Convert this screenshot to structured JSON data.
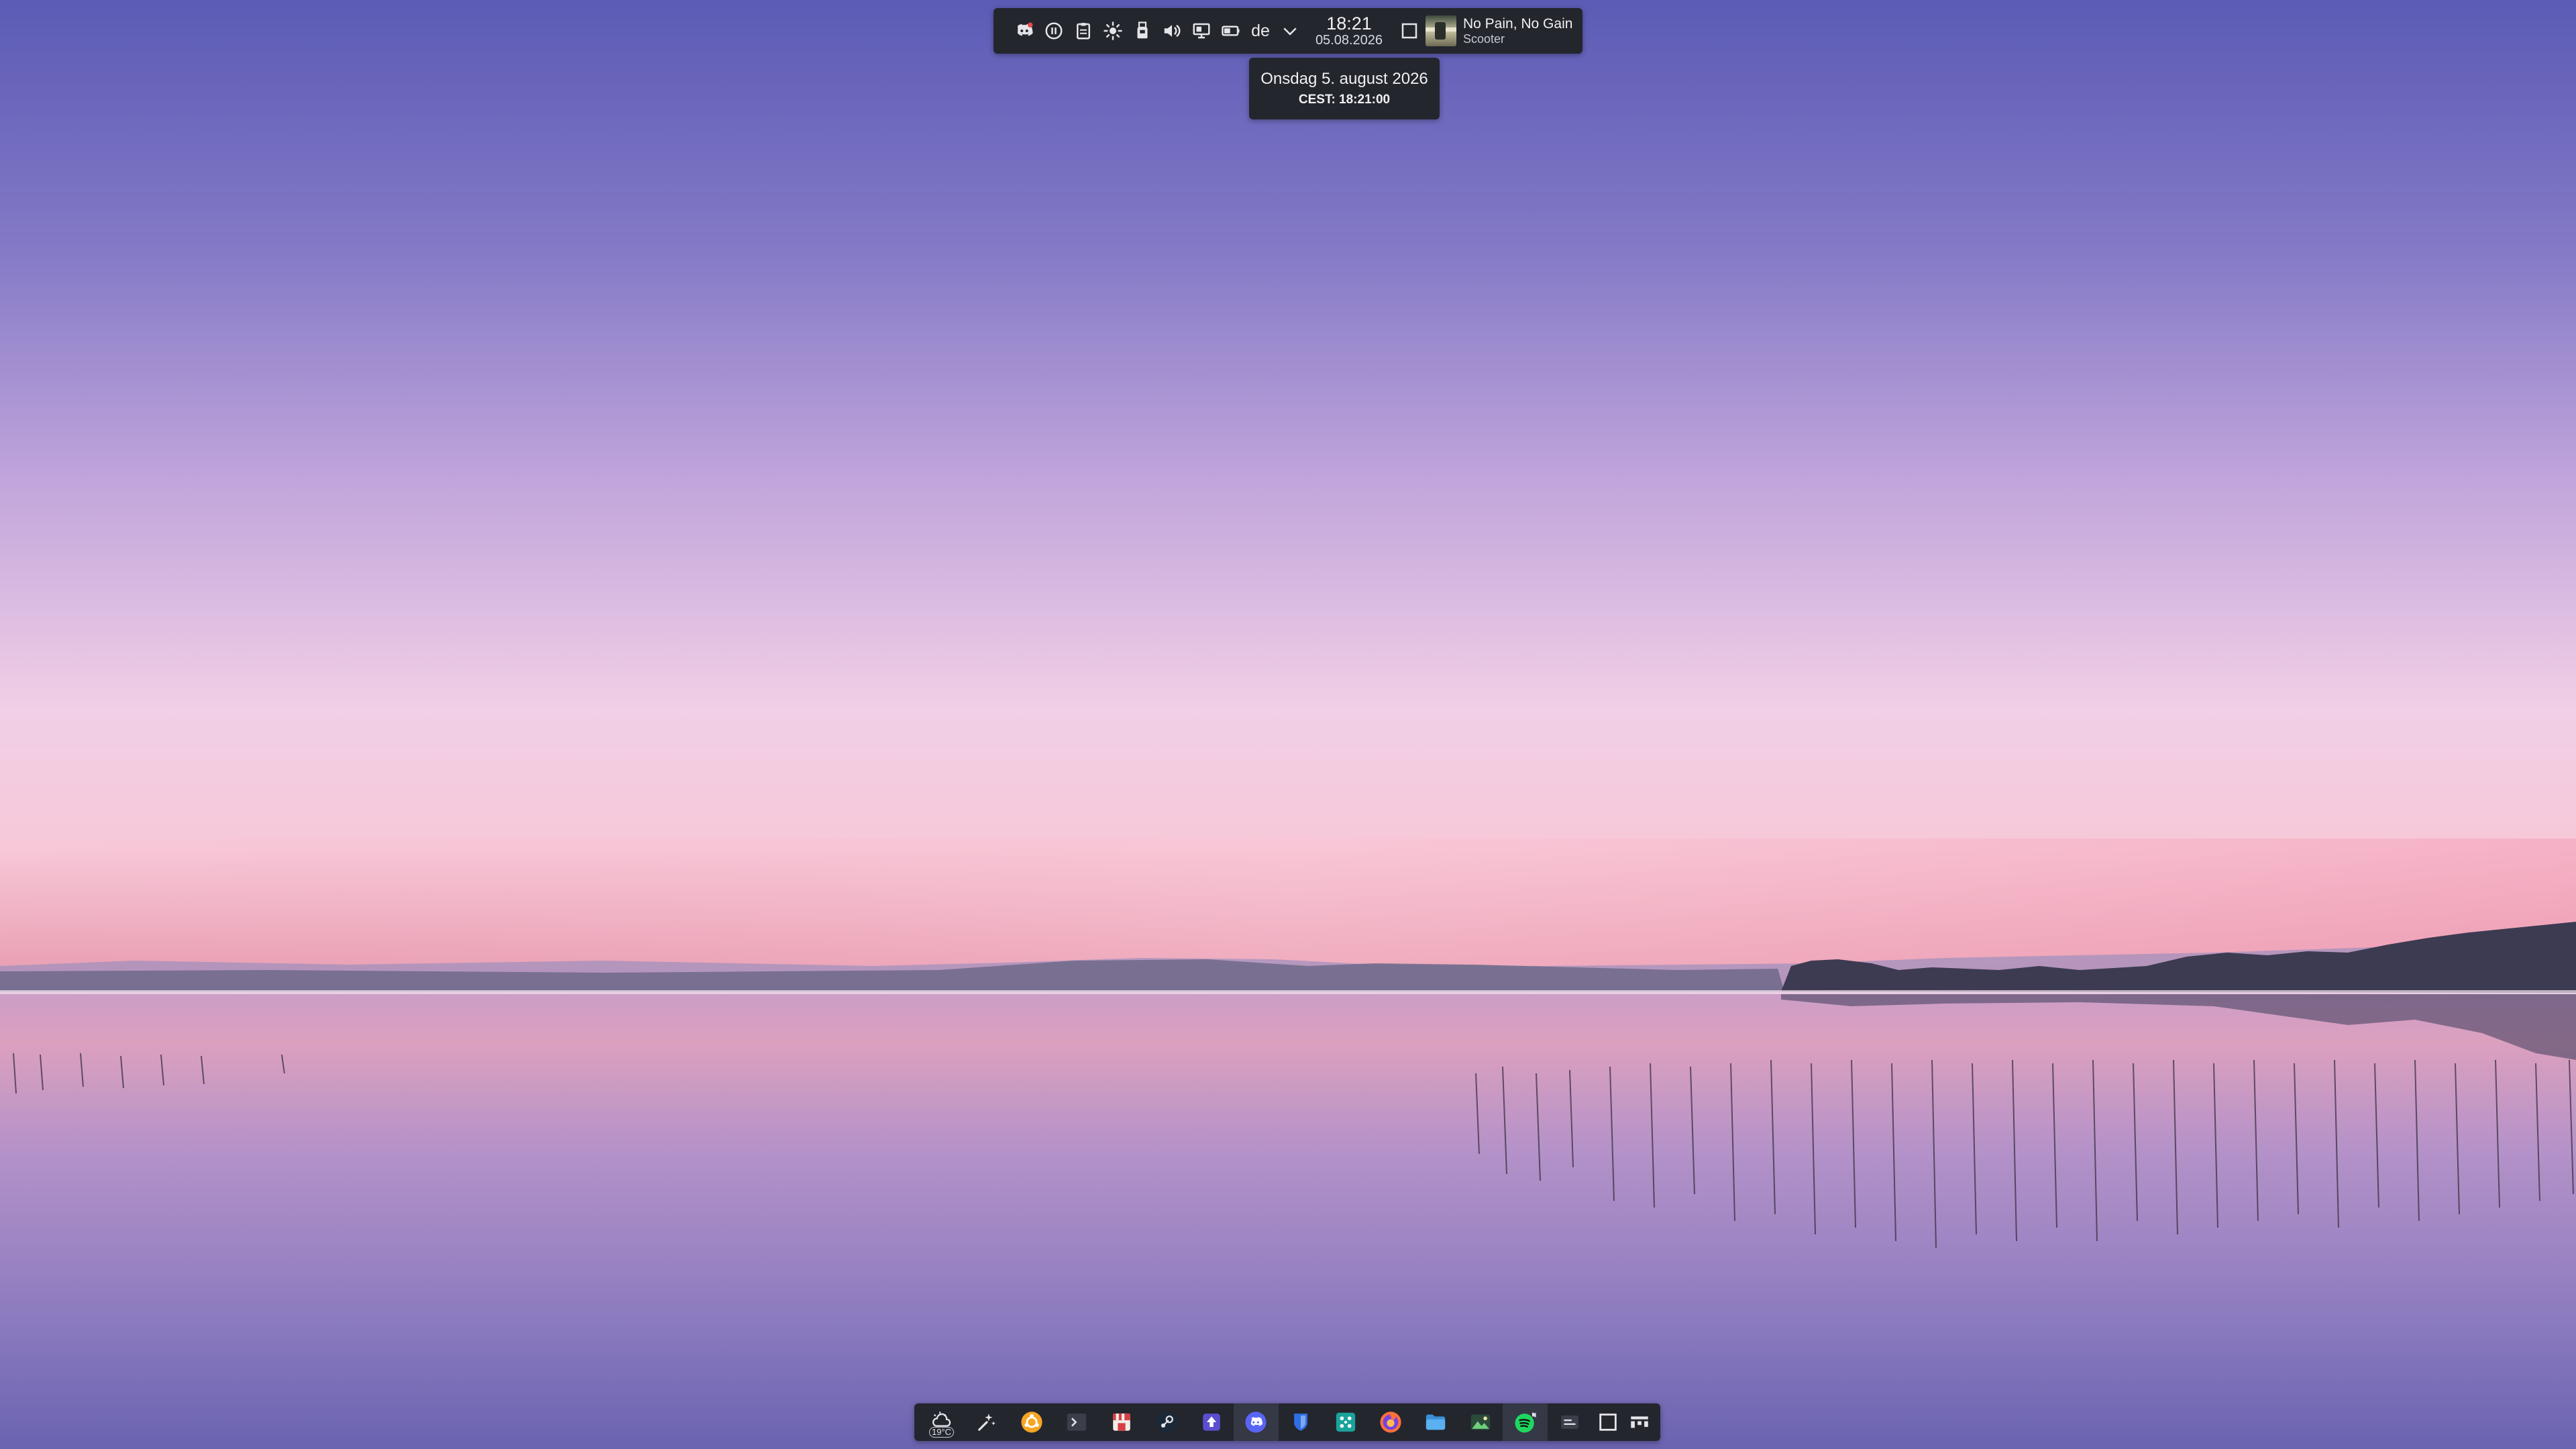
{
  "top_panel": {
    "tray_icons": [
      {
        "name": "discord-icon"
      },
      {
        "name": "media-pause-icon"
      },
      {
        "name": "clipboard-icon"
      },
      {
        "name": "brightness-icon"
      },
      {
        "name": "usb-device-icon"
      },
      {
        "name": "volume-icon"
      },
      {
        "name": "display-icon"
      },
      {
        "name": "battery-icon"
      }
    ],
    "keyboard_layout": "de",
    "expand_icon": "chevron-down-icon",
    "clock": {
      "time": "18:21",
      "date": "05.08.2026"
    },
    "show_desktop_icon": "show-desktop-icon",
    "media": {
      "title": "No Pain, No Gain",
      "artist": "Scooter"
    }
  },
  "tooltip": {
    "day": "Onsdag 5. august 2026",
    "timezone": "CEST: 18:21:00"
  },
  "dock": {
    "weather_temp": "19°C",
    "items": [
      "weather-icon",
      "launcher-icon",
      "ubuntu-icon",
      "terminal-icon",
      "store-icon",
      "steam-icon",
      "uploader-icon",
      "discord-icon",
      "bitwarden-icon",
      "app-grid-icon",
      "firefox-icon",
      "files-icon",
      "image-viewer-icon",
      "spotify-icon",
      "window-switcher-icon",
      "show-desktop-icon",
      "pager-icon"
    ]
  }
}
